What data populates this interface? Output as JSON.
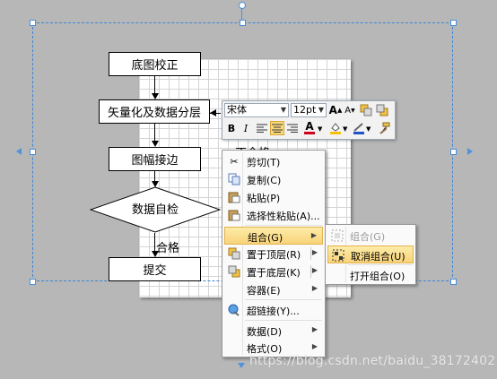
{
  "flowchart": {
    "steps": [
      "底图校正",
      "矢量化及数据分层",
      "图幅接边",
      "数据自检",
      "提交"
    ],
    "branch_label": "合格",
    "partial_text": "不合格"
  },
  "mini_toolbar": {
    "font_name": "宋体",
    "font_size": "12pt",
    "bold": "B",
    "italic": "I",
    "grow_font": "A",
    "shrink_font": "A",
    "font_color_letter": "A"
  },
  "context_menu": {
    "items": [
      {
        "label": "剪切(T)",
        "icon": "scissors-icon"
      },
      {
        "label": "复制(C)",
        "icon": "copy-icon"
      },
      {
        "label": "粘贴(P)",
        "icon": "paste-icon"
      },
      {
        "label": "选择性粘贴(A)...",
        "icon": "paste-special-icon"
      },
      {
        "label": "组合(G)",
        "icon": ""
      },
      {
        "label": "置于顶层(R)",
        "icon": "bring-to-front-icon"
      },
      {
        "label": "置于底层(K)",
        "icon": "send-to-back-icon"
      },
      {
        "label": "容器(E)",
        "icon": ""
      },
      {
        "label": "超链接(Y)...",
        "icon": "hyperlink-icon"
      },
      {
        "label": "数据(D)",
        "icon": ""
      },
      {
        "label": "格式(O)",
        "icon": ""
      }
    ]
  },
  "group_submenu": {
    "items": [
      {
        "label": "组合(G)",
        "disabled": true
      },
      {
        "label": "取消组合(U)",
        "highlighted": true
      },
      {
        "label": "打开组合(O)"
      }
    ]
  },
  "watermark": "https://blog.csdn.net/baidu_38172402",
  "colors": {
    "selection": "#3b86d6",
    "highlight": "#f8d37a",
    "canvas": "#b7b7b7"
  }
}
